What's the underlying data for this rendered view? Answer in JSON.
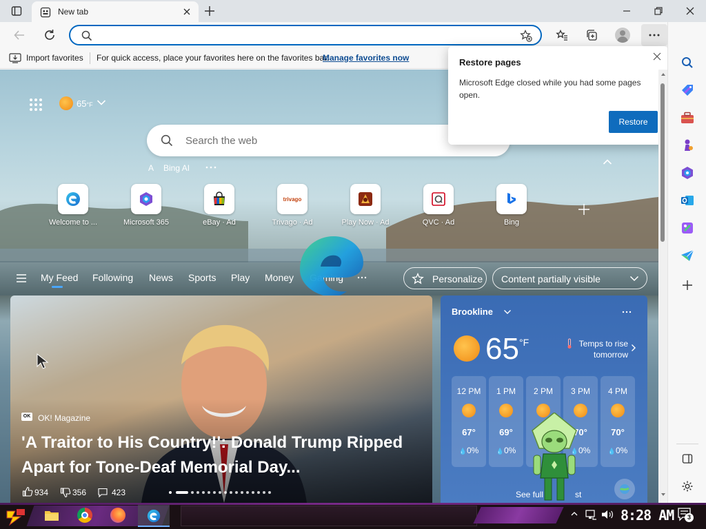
{
  "browser": {
    "tab_title": "New tab",
    "address_value": "",
    "favorites_bar": {
      "import_label": "Import favorites",
      "hint": "For quick access, place your favorites here on the favorites bar.",
      "manage_link": "Manage favorites now"
    }
  },
  "popup": {
    "title": "Restore pages",
    "message": "Microsoft Edge closed while you had some pages open.",
    "restore_button": "Restore"
  },
  "newtab": {
    "weather_badge": "65",
    "weather_unit": "°F",
    "search_placeholder": "Search the web",
    "bing_ai_label": "Bing AI",
    "bing_ai_letter": "A",
    "quick_links": [
      {
        "label": "Welcome to ...",
        "icon": "edge-icon"
      },
      {
        "label": "Microsoft 365",
        "icon": "m365-icon"
      },
      {
        "label": "eBay · Ad",
        "icon": "ebay-icon"
      },
      {
        "label": "Trivago · Ad",
        "icon": "trivago-icon"
      },
      {
        "label": "Play Now · Ad",
        "icon": "game-icon"
      },
      {
        "label": "QVC · Ad",
        "icon": "qvc-icon"
      },
      {
        "label": "Bing",
        "icon": "bing-icon"
      }
    ],
    "trivago_text": "trivago",
    "feed_nav": [
      "My Feed",
      "Following",
      "News",
      "Sports",
      "Play",
      "Money",
      "Gaming"
    ],
    "personalize_label": "Personalize",
    "content_visibility": "Content partially visible"
  },
  "article": {
    "source": "OK! Magazine",
    "source_badge": "OK",
    "headline": "'A Traitor to His Country!': Donald Trump Ripped Apart for Tone-Deaf Memorial Day...",
    "likes": "934",
    "dislikes": "356",
    "comments": "423"
  },
  "weather": {
    "location": "Brookline",
    "temp": "65",
    "unit": "°F",
    "note": "Temps to rise tomorrow",
    "hourly": [
      {
        "hour": "12 PM",
        "temp": "67°",
        "precip": "0%"
      },
      {
        "hour": "1 PM",
        "temp": "69°",
        "precip": "0%"
      },
      {
        "hour": "2 PM",
        "temp": "",
        "precip": ""
      },
      {
        "hour": "3 PM",
        "temp": "70°",
        "precip": "0%"
      },
      {
        "hour": "4 PM",
        "temp": "70°",
        "precip": "0%"
      }
    ],
    "see_full": "See full",
    "see_full_end": "st"
  },
  "taskbar": {
    "clock": "8:28 AM",
    "notification_count": "3"
  },
  "colors": {
    "accent": "#0067c0",
    "restore_button": "#0f6cbd"
  }
}
